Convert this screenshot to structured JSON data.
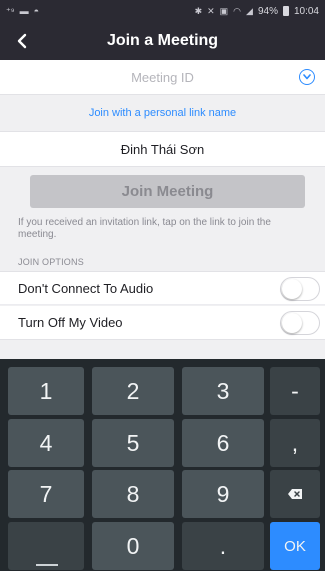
{
  "status_bar": {
    "battery": "94%",
    "time": "10:04"
  },
  "header": {
    "title": "Join a Meeting"
  },
  "meeting_id": {
    "placeholder": "Meeting ID"
  },
  "personal_link": {
    "label": "Join with a personal link name"
  },
  "name_field": {
    "value": "Đinh Thái Sơn"
  },
  "join_button": {
    "label": "Join Meeting"
  },
  "hint_text": "If you received an invitation link, tap on the link to join the meeting.",
  "join_options": {
    "header": "JOIN OPTIONS",
    "items": [
      {
        "label": "Don't Connect To Audio",
        "on": false
      },
      {
        "label": "Turn Off My Video",
        "on": false
      }
    ]
  },
  "keyboard": {
    "k1": "1",
    "k2": "2",
    "k3": "3",
    "dash": "-",
    "k4": "4",
    "k5": "5",
    "k6": "6",
    "comma": ",",
    "k7": "7",
    "k8": "8",
    "k9": "9",
    "k0": "0",
    "dot": ".",
    "ok": "OK"
  },
  "colors": {
    "accent": "#2d8cff",
    "header_bg": "#2b2a33",
    "keyboard_bg": "#23292d"
  }
}
